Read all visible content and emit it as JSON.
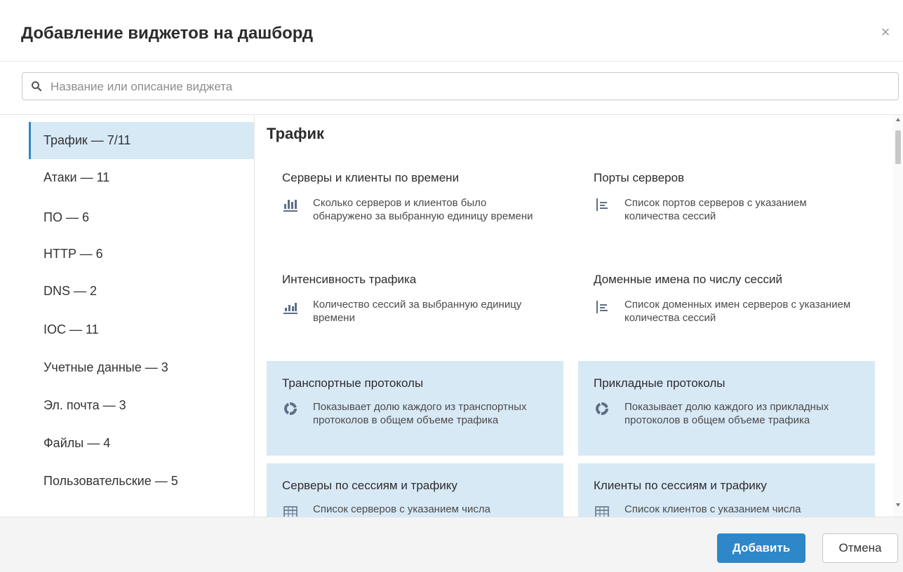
{
  "dialog": {
    "title": "Добавление виджетов на дашборд",
    "close_label": "×"
  },
  "search": {
    "placeholder": "Название или описание виджета",
    "value": ""
  },
  "sidebar": {
    "items": [
      {
        "label": "Трафик — 7/11",
        "active": true
      },
      {
        "label": "Атаки — 11"
      },
      {
        "label": "ПО — 6"
      },
      {
        "label": "HTTP — 6"
      },
      {
        "label": "DNS — 2"
      },
      {
        "label": "IOC — 11"
      },
      {
        "label": "Учетные данные — 3"
      },
      {
        "label": "Эл. почта — 3"
      },
      {
        "label": "Файлы — 4"
      },
      {
        "label": "Пользовательские — 5"
      }
    ]
  },
  "section": {
    "title": "Трафик"
  },
  "widgets": [
    {
      "title": "Серверы и клиенты по времени",
      "desc": "Сколько серверов и клиентов было обнаружено за выбранную единицу времени",
      "icon": "stacked-bar-chart-icon",
      "selected": false
    },
    {
      "title": "Порты серверов",
      "desc": "Список портов серверов с указанием количества сессий",
      "icon": "list-chart-icon",
      "selected": false
    },
    {
      "title": "Интенсивность трафика",
      "desc": "Количество сессий за выбранную единицу времени",
      "icon": "bar-chart-icon",
      "selected": false
    },
    {
      "title": "Доменные имена по числу сессий",
      "desc": "Список доменных имен серверов с указанием количества сессий",
      "icon": "list-chart-icon",
      "selected": false
    },
    {
      "title": "Транспортные протоколы",
      "desc": "Показывает долю каждого из транспортных протоколов в общем объеме трафика",
      "icon": "donut-chart-icon",
      "selected": true
    },
    {
      "title": "Прикладные протоколы",
      "desc": "Показывает долю каждого из прикладных протоколов в общем объеме трафика",
      "icon": "donut-chart-icon",
      "selected": true
    },
    {
      "title": "Серверы по сессиям и трафику",
      "desc": "Список серверов с указанием числа",
      "icon": "table-icon",
      "selected": true
    },
    {
      "title": "Клиенты по сессиям и трафику",
      "desc": "Список клиентов с указанием числа",
      "icon": "table-icon",
      "selected": true
    }
  ],
  "footer": {
    "add_label": "Добавить",
    "cancel_label": "Отмена"
  },
  "colors": {
    "accent": "#2d87c8",
    "selected_bg": "#d8e9f6"
  }
}
